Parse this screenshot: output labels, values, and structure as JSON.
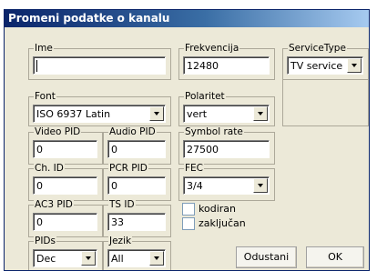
{
  "window": {
    "title": "Promeni podatke o kanalu"
  },
  "fields": {
    "ime": {
      "label": "Ime",
      "value": ""
    },
    "frekvencija": {
      "label": "Frekvencija",
      "value": "12480"
    },
    "service_type": {
      "label": "ServiceType",
      "value": "TV service"
    },
    "font": {
      "label": "Font",
      "value": "ISO 6937 Latin"
    },
    "polaritet": {
      "label": "Polaritet",
      "value": "vert"
    },
    "video_pid": {
      "label": "Video PID",
      "value": "0"
    },
    "audio_pid": {
      "label": "Audio PID",
      "value": "0"
    },
    "symbol_rate": {
      "label": "Symbol rate",
      "value": "27500"
    },
    "ch_id": {
      "label": "Ch. ID",
      "value": "0"
    },
    "pcr_pid": {
      "label": "PCR PID",
      "value": "0"
    },
    "fec": {
      "label": "FEC",
      "value": "3/4"
    },
    "ac3_pid": {
      "label": "AC3 PID",
      "value": "0"
    },
    "ts_id": {
      "label": "TS ID",
      "value": "33"
    },
    "pids": {
      "label": "PIDs",
      "value": "Dec"
    },
    "jezik": {
      "label": "Jezik",
      "value": "All"
    }
  },
  "checkboxes": {
    "kodiran": {
      "label": "kodiran",
      "checked": false
    },
    "zakljucan": {
      "label": "zaključan",
      "checked": false
    }
  },
  "buttons": {
    "cancel": "Odustani",
    "ok": "OK"
  }
}
